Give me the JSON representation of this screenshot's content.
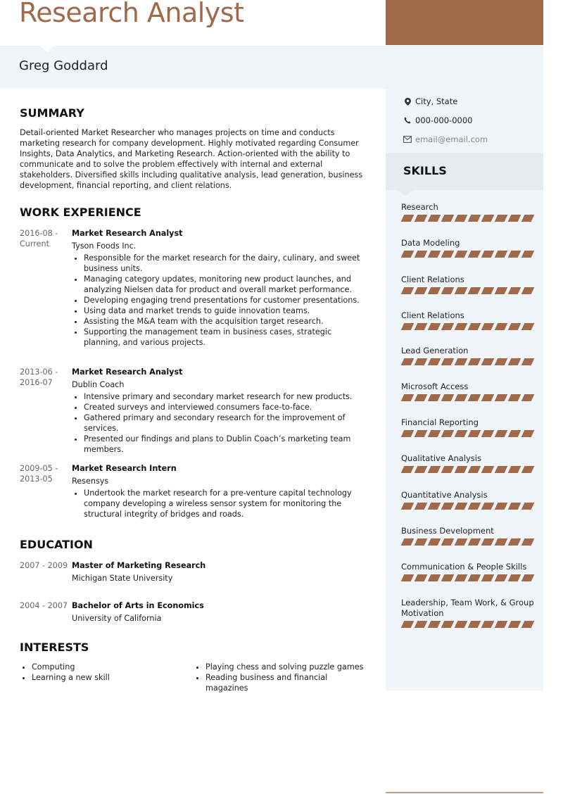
{
  "header": {
    "title": "Research Analyst",
    "name": "Greg Goddard"
  },
  "colors": {
    "accent": "#a0694a",
    "band": "#f0f5f9",
    "skills_header": "#e6ebef"
  },
  "contact": {
    "location": {
      "icon": "map-pin-icon",
      "text": "City, State"
    },
    "phone": {
      "icon": "phone-icon",
      "text": "000-000-0000"
    },
    "email": {
      "icon": "envelope-icon",
      "text": "email@email.com"
    }
  },
  "skills": {
    "title": "SKILLS",
    "items": [
      {
        "label": "Research",
        "level": 1.0
      },
      {
        "label": "Data Modeling",
        "level": 1.0
      },
      {
        "label": "Client Relations",
        "level": 1.0
      },
      {
        "label": "Client Relations",
        "level": 1.0
      },
      {
        "label": "Lead Generation",
        "level": 1.0
      },
      {
        "label": "Microsoft Access",
        "level": 1.0
      },
      {
        "label": "Financial Reporting",
        "level": 1.0
      },
      {
        "label": "Qualitative Analysis",
        "level": 1.0
      },
      {
        "label": "Quantitative Analysis",
        "level": 1.0
      },
      {
        "label": "Business Development",
        "level": 1.0
      },
      {
        "label": "Communication & People Skills",
        "level": 1.0
      },
      {
        "label": "Leadership, Team Work, & Group Motivation",
        "level": 1.0
      }
    ]
  },
  "summary": {
    "title": "SUMMARY",
    "text": "Detail-oriented Market Researcher who manages projects on time and conducts marketing research for company development. Highly motivated regarding Consumer Insights, Data Analytics, and Marketing Research. Action-oriented with the ability to communicate and to solve the problem effectively with internal and external stakeholders. Diversified skills including qualitative analysis, lead generation, business development, financial reporting, and client relations."
  },
  "work": {
    "title": "WORK EXPERIENCE",
    "jobs": [
      {
        "date": "2016-08 - Current",
        "role": "Market Research Analyst",
        "company": "Tyson Foods Inc.",
        "bullets": [
          "Responsible for the market research for the dairy, culinary, and sweet business units.",
          "Managing category updates, monitoring new product launches, and analyzing Nielsen data for product and overall market performance.",
          "Developing engaging trend presentations for customer presentations.",
          "Using data and market trends to guide innovation teams.",
          "Assisting the M&A team with the acquisition target research.",
          "Supporting the management team in business cases, strategic planning, and various projects."
        ]
      },
      {
        "date": "2013-06 - 2016-07",
        "role": "Market Research Analyst",
        "company": "Dublin Coach",
        "bullets": [
          "Intensive primary and secondary market research for new products.",
          "Created surveys and interviewed consumers face-to-face.",
          "Gathered primary and secondary research for the improvement of services.",
          "Presented our findings and plans to Dublin Coach’s marketing team members."
        ]
      },
      {
        "date": "2009-05 - 2013-05",
        "role": "Market Research Intern",
        "company": "Resensys",
        "bullets": [
          "Undertook the market research for a pre-venture capital technology company developing a wireless sensor system for monitoring the structural integrity of bridges and roads."
        ]
      }
    ]
  },
  "education": {
    "title": "EDUCATION",
    "items": [
      {
        "date": "2007 - 2009",
        "degree": "Master of Marketing Research",
        "school": "Michigan State University"
      },
      {
        "date": "2004 - 2007",
        "degree": "Bachelor of Arts in Economics",
        "school": "University of California"
      }
    ]
  },
  "interests": {
    "title": "INTERESTS",
    "col1": [
      "Computing",
      "Learning a new skill"
    ],
    "col2": [
      "Playing chess and solving puzzle games",
      "Reading business and financial magazines"
    ]
  }
}
